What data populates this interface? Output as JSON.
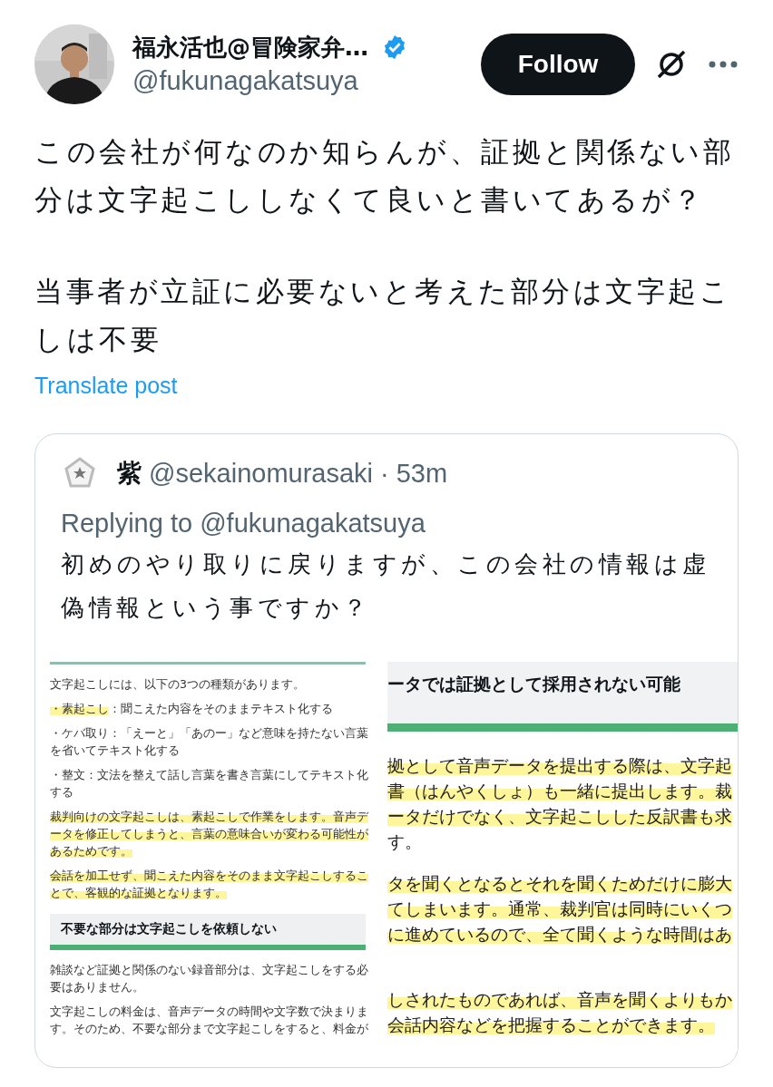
{
  "author": {
    "name": "福永活也@冒険家弁…",
    "handle": "@fukunagakatsuya",
    "verified": true
  },
  "follow_button": {
    "label": "Follow"
  },
  "post": {
    "paragraphs": [
      "この会社が何なのか知らんが、証拠と関係ない部分は文字起こししなくて良いと書いてあるが？",
      "当事者が立証に必要ないと考えた部分は文字起こしは不要"
    ],
    "translate_link": "Translate post"
  },
  "quoted_post": {
    "name": "紫",
    "handle": "@sekainomurasaki",
    "separator": "·",
    "time": "53m",
    "replying_to": "Replying to @fukunagakatsuya",
    "text": "初めのやり取りに戻りますが、この会社の情報は虚偽情報という事ですか？",
    "attachment": {
      "documents": [
        {
          "blocks": [
            {
              "kind": "paragraph",
              "lines": [
                [
                  {
                    "text": "文字起こしには、以下の3つの種類があります。",
                    "highlighted": false
                  }
                ]
              ]
            },
            {
              "kind": "paragraph",
              "lines": [
                [
                  {
                    "text": "・素起こし",
                    "highlighted": true
                  },
                  {
                    "text": "：聞こえた内容をそのままテキスト化する",
                    "highlighted": false
                  }
                ]
              ]
            },
            {
              "kind": "paragraph",
              "lines": [
                [
                  {
                    "text": "・ケバ取り：「えーと」「あのー」など意味を持たない言葉",
                    "highlighted": false
                  }
                ],
                [
                  {
                    "text": "を省いてテキスト化する",
                    "highlighted": false
                  }
                ]
              ]
            },
            {
              "kind": "paragraph",
              "lines": [
                [
                  {
                    "text": "・整文：文法を整えて話し言葉を書き言葉にしてテキスト化",
                    "highlighted": false
                  }
                ],
                [
                  {
                    "text": "する",
                    "highlighted": false
                  }
                ]
              ]
            },
            {
              "kind": "paragraph",
              "lines": [
                [
                  {
                    "text": "裁判向けの文字起こしは、素起こしで作業をします。音声デ",
                    "highlighted": true
                  }
                ],
                [
                  {
                    "text": "ータを修正してしまうと、言葉の意味合いが変わる可能性が",
                    "highlighted": true
                  }
                ],
                [
                  {
                    "text": "あるためです。",
                    "highlighted": true
                  }
                ]
              ]
            },
            {
              "kind": "paragraph",
              "lines": [
                [
                  {
                    "text": "会話を加工せず、聞こえた内容をそのまま文字起こしするこ",
                    "highlighted": true
                  }
                ],
                [
                  {
                    "text": "とで、客観的な証拠となります。",
                    "highlighted": true
                  }
                ]
              ]
            },
            {
              "kind": "heading",
              "text": "不要な部分は文字起こしを依頼しない"
            },
            {
              "kind": "paragraph",
              "lines": [
                [
                  {
                    "text": "雑談など証拠と関係のない録音部分は、文字起こしをする必",
                    "highlighted": false
                  }
                ],
                [
                  {
                    "text": "要はありません。",
                    "highlighted": false
                  }
                ]
              ]
            },
            {
              "kind": "paragraph",
              "lines": [
                [
                  {
                    "text": "文字起こしの料金は、音声データの時間や文字数で決まりま",
                    "highlighted": false
                  }
                ],
                [
                  {
                    "text": "す。そのため、不要な部分まで文字起こしをすると、料金が",
                    "highlighted": false
                  }
                ]
              ]
            }
          ]
        },
        {
          "blocks": [
            {
              "kind": "heading",
              "text": "ータでは証拠として採用されない可能"
            },
            {
              "kind": "paragraph",
              "lines": [
                [
                  {
                    "text": "拠として音声データを提出する際は、文字起",
                    "highlighted": true
                  }
                ],
                [
                  {
                    "text": "書（はんやくしょ）も一緒に提出します。裁",
                    "highlighted": true
                  }
                ],
                [
                  {
                    "text": "ータだけでなく、文字起こしした反訳書も求",
                    "highlighted": true
                  }
                ],
                [
                  {
                    "text": "す。",
                    "highlighted": false
                  }
                ]
              ]
            },
            {
              "kind": "paragraph",
              "lines": [
                [
                  {
                    "text": "タを聞くとなるとそれを聞くためだけに膨大",
                    "highlighted": true
                  }
                ],
                [
                  {
                    "text": "てしまいます。通常、裁判官は同時にいくつ",
                    "highlighted": true
                  }
                ],
                [
                  {
                    "text": "に進めているので、全て聞くような時間はあ",
                    "highlighted": true
                  }
                ]
              ]
            },
            {
              "kind": "paragraph",
              "lines": [
                [
                  {
                    "text": "しされたものであれば、音声を聞くよりもか",
                    "highlighted": true
                  }
                ],
                [
                  {
                    "text": "会話内容などを把握することができます。",
                    "highlighted": true
                  }
                ]
              ]
            }
          ]
        }
      ]
    }
  }
}
